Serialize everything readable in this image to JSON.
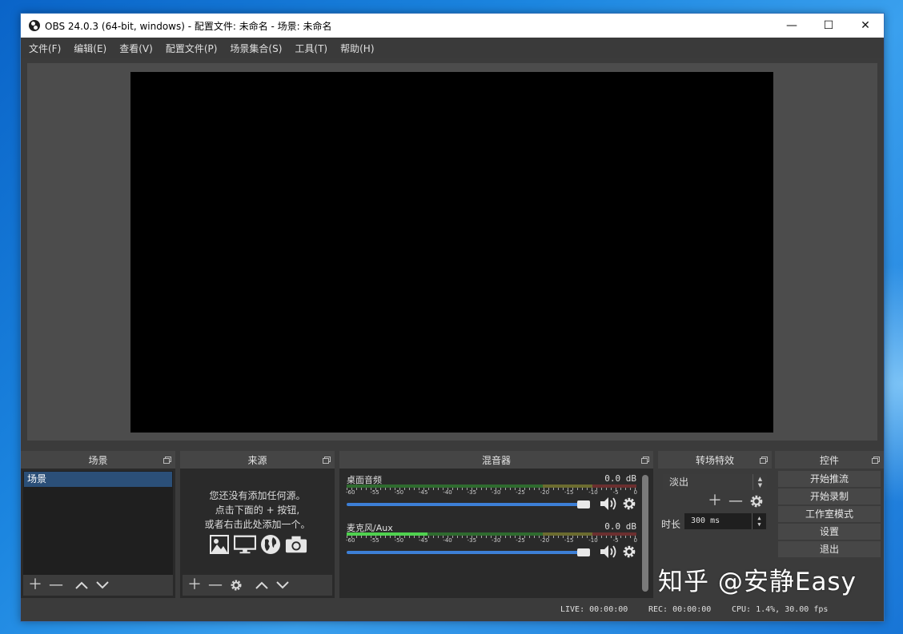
{
  "window": {
    "title": "OBS 24.0.3 (64-bit, windows) - 配置文件: 未命名 - 场景: 未命名",
    "controls": {
      "minimize": "—",
      "maximize": "☐",
      "close": "✕"
    }
  },
  "menu": [
    "文件(F)",
    "编辑(E)",
    "查看(V)",
    "配置文件(P)",
    "场景集合(S)",
    "工具(T)",
    "帮助(H)"
  ],
  "scenes": {
    "title": "场景",
    "items": [
      "场景"
    ]
  },
  "sources": {
    "title": "来源",
    "empty_lines": [
      "您还没有添加任何源。",
      "点击下面的 + 按钮,",
      "或者右击此处添加一个。"
    ],
    "icons": [
      "image-icon",
      "monitor-icon",
      "globe-icon",
      "camera-icon"
    ]
  },
  "mixer": {
    "title": "混音器",
    "scale": [
      "-60",
      "-55",
      "-50",
      "-45",
      "-40",
      "-35",
      "-30",
      "-25",
      "-20",
      "-15",
      "-10",
      "-5",
      "0"
    ],
    "tracks": [
      {
        "name": "桌面音频",
        "db": "0.0 dB",
        "level": 0,
        "volume": 1.0
      },
      {
        "name": "麦克风/Aux",
        "db": "0.0 dB",
        "level": 0.28,
        "volume": 1.0
      }
    ]
  },
  "transitions": {
    "title": "转场特效",
    "selected": "淡出",
    "duration_label": "时长",
    "duration_value": "300 ms"
  },
  "controls": {
    "title": "控件",
    "buttons": [
      "开始推流",
      "开始录制",
      "工作室模式",
      "设置",
      "退出"
    ]
  },
  "status": {
    "live": "LIVE: 00:00:00",
    "rec": "REC: 00:00:00",
    "cpu": "CPU: 1.4%, 30.00 fps"
  },
  "watermark": "知乎 @安静Easy",
  "colors": {
    "accent": "#3d7fd6",
    "selection": "#2b4f78",
    "meter_green": "#4fd14f",
    "panel_bg": "#1f1f1f"
  }
}
